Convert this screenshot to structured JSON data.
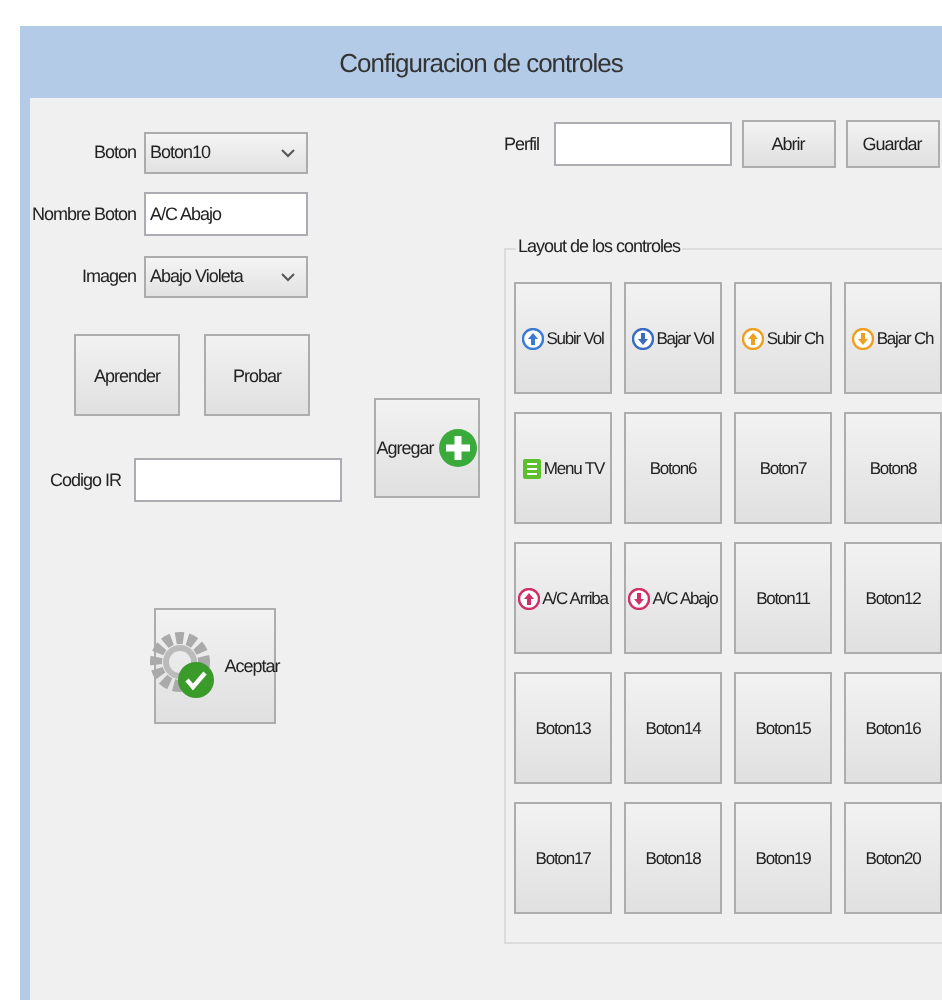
{
  "window": {
    "title": "Configuracion de controles"
  },
  "form": {
    "boton_label": "Boton",
    "boton_value": "Boton10",
    "nombre_label": "Nombre Boton",
    "nombre_value": "A/C Abajo",
    "imagen_label": "Imagen",
    "imagen_value": "Abajo Violeta",
    "codigo_label": "Codigo IR"
  },
  "buttons": {
    "aprender": "Aprender",
    "probar": "Probar",
    "agregar": "Agregar",
    "aceptar": "Aceptar"
  },
  "perfil": {
    "label": "Perfil",
    "abrir": "Abrir",
    "guardar": "Guardar"
  },
  "layout": {
    "title": "Layout de los controles",
    "items": [
      {
        "label": "Subir Vol",
        "kind": "up",
        "color": "#3a7bd5"
      },
      {
        "label": "Bajar Vol",
        "kind": "down",
        "color": "#3a6cc0"
      },
      {
        "label": "Subir Ch",
        "kind": "up",
        "color": "#f0a020"
      },
      {
        "label": "Bajar Ch",
        "kind": "down",
        "color": "#f0a020"
      },
      {
        "label": "Menu TV",
        "kind": "menu",
        "color": "#5cc02c"
      },
      {
        "label": "Boton6",
        "kind": "plain"
      },
      {
        "label": "Boton7",
        "kind": "plain"
      },
      {
        "label": "Boton8",
        "kind": "plain"
      },
      {
        "label": "A/C Arriba",
        "kind": "up",
        "color": "#d0306a"
      },
      {
        "label": "A/C Abajo",
        "kind": "down",
        "color": "#d0306a"
      },
      {
        "label": "Boton11",
        "kind": "plain"
      },
      {
        "label": "Boton12",
        "kind": "plain"
      },
      {
        "label": "Boton13",
        "kind": "plain"
      },
      {
        "label": "Boton14",
        "kind": "plain"
      },
      {
        "label": "Boton15",
        "kind": "plain"
      },
      {
        "label": "Boton16",
        "kind": "plain"
      },
      {
        "label": "Boton17",
        "kind": "plain"
      },
      {
        "label": "Boton18",
        "kind": "plain"
      },
      {
        "label": "Boton19",
        "kind": "plain"
      },
      {
        "label": "Boton20",
        "kind": "plain"
      }
    ]
  }
}
